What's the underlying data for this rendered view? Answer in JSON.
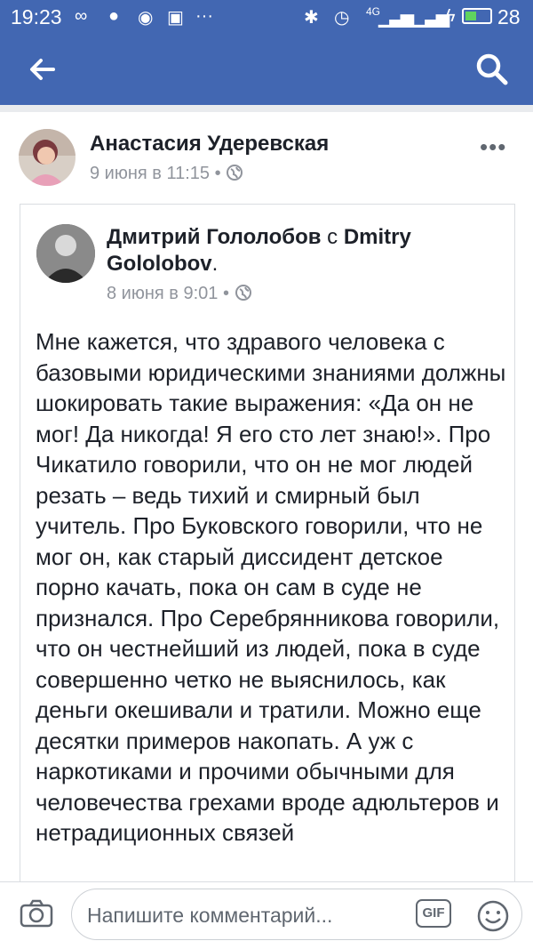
{
  "status_bar": {
    "time": "19:23",
    "battery": "28",
    "network": "4G"
  },
  "nav": {
    "back_icon": "arrow-left-icon",
    "search_icon": "search-icon",
    "bar_color": "#4267b2"
  },
  "post": {
    "author": "Анастасия Удеревская",
    "meta": "9 июня в 11:15 • ",
    "more": "•••"
  },
  "shared_post": {
    "author": "Дмитрий Гололобов",
    "with_text": " с ",
    "tagged": "Dmitry Gololobov",
    "suffix": ".",
    "meta": "8 июня в 9:01 • ",
    "body": "Мне кажется, что здравого человека с базовыми юридическими знаниями должны шокировать такие выражения: «Да он не мог! Да никогда! Я его сто лет знаю!». Про Чикатило говорили, что он не мог людей резать – ведь тихий и смирный был учитель. Про Буковского говорили, что не мог он, как старый диссидент детское порно качать, пока он сам в суде не признался. Про Серебрянникова говорили, что он честнейший из людей, пока в суде совершенно четко не выяснилось, как деньги окешивали и тратили. Можно еще десятки примеров накопать. А уж с наркотиками и прочими обычными для человечества грехами вроде адюльтеров и нетрадиционных связей"
  },
  "comment_bar": {
    "placeholder": "Напишите комментарий...",
    "gif_label": "GIF"
  }
}
